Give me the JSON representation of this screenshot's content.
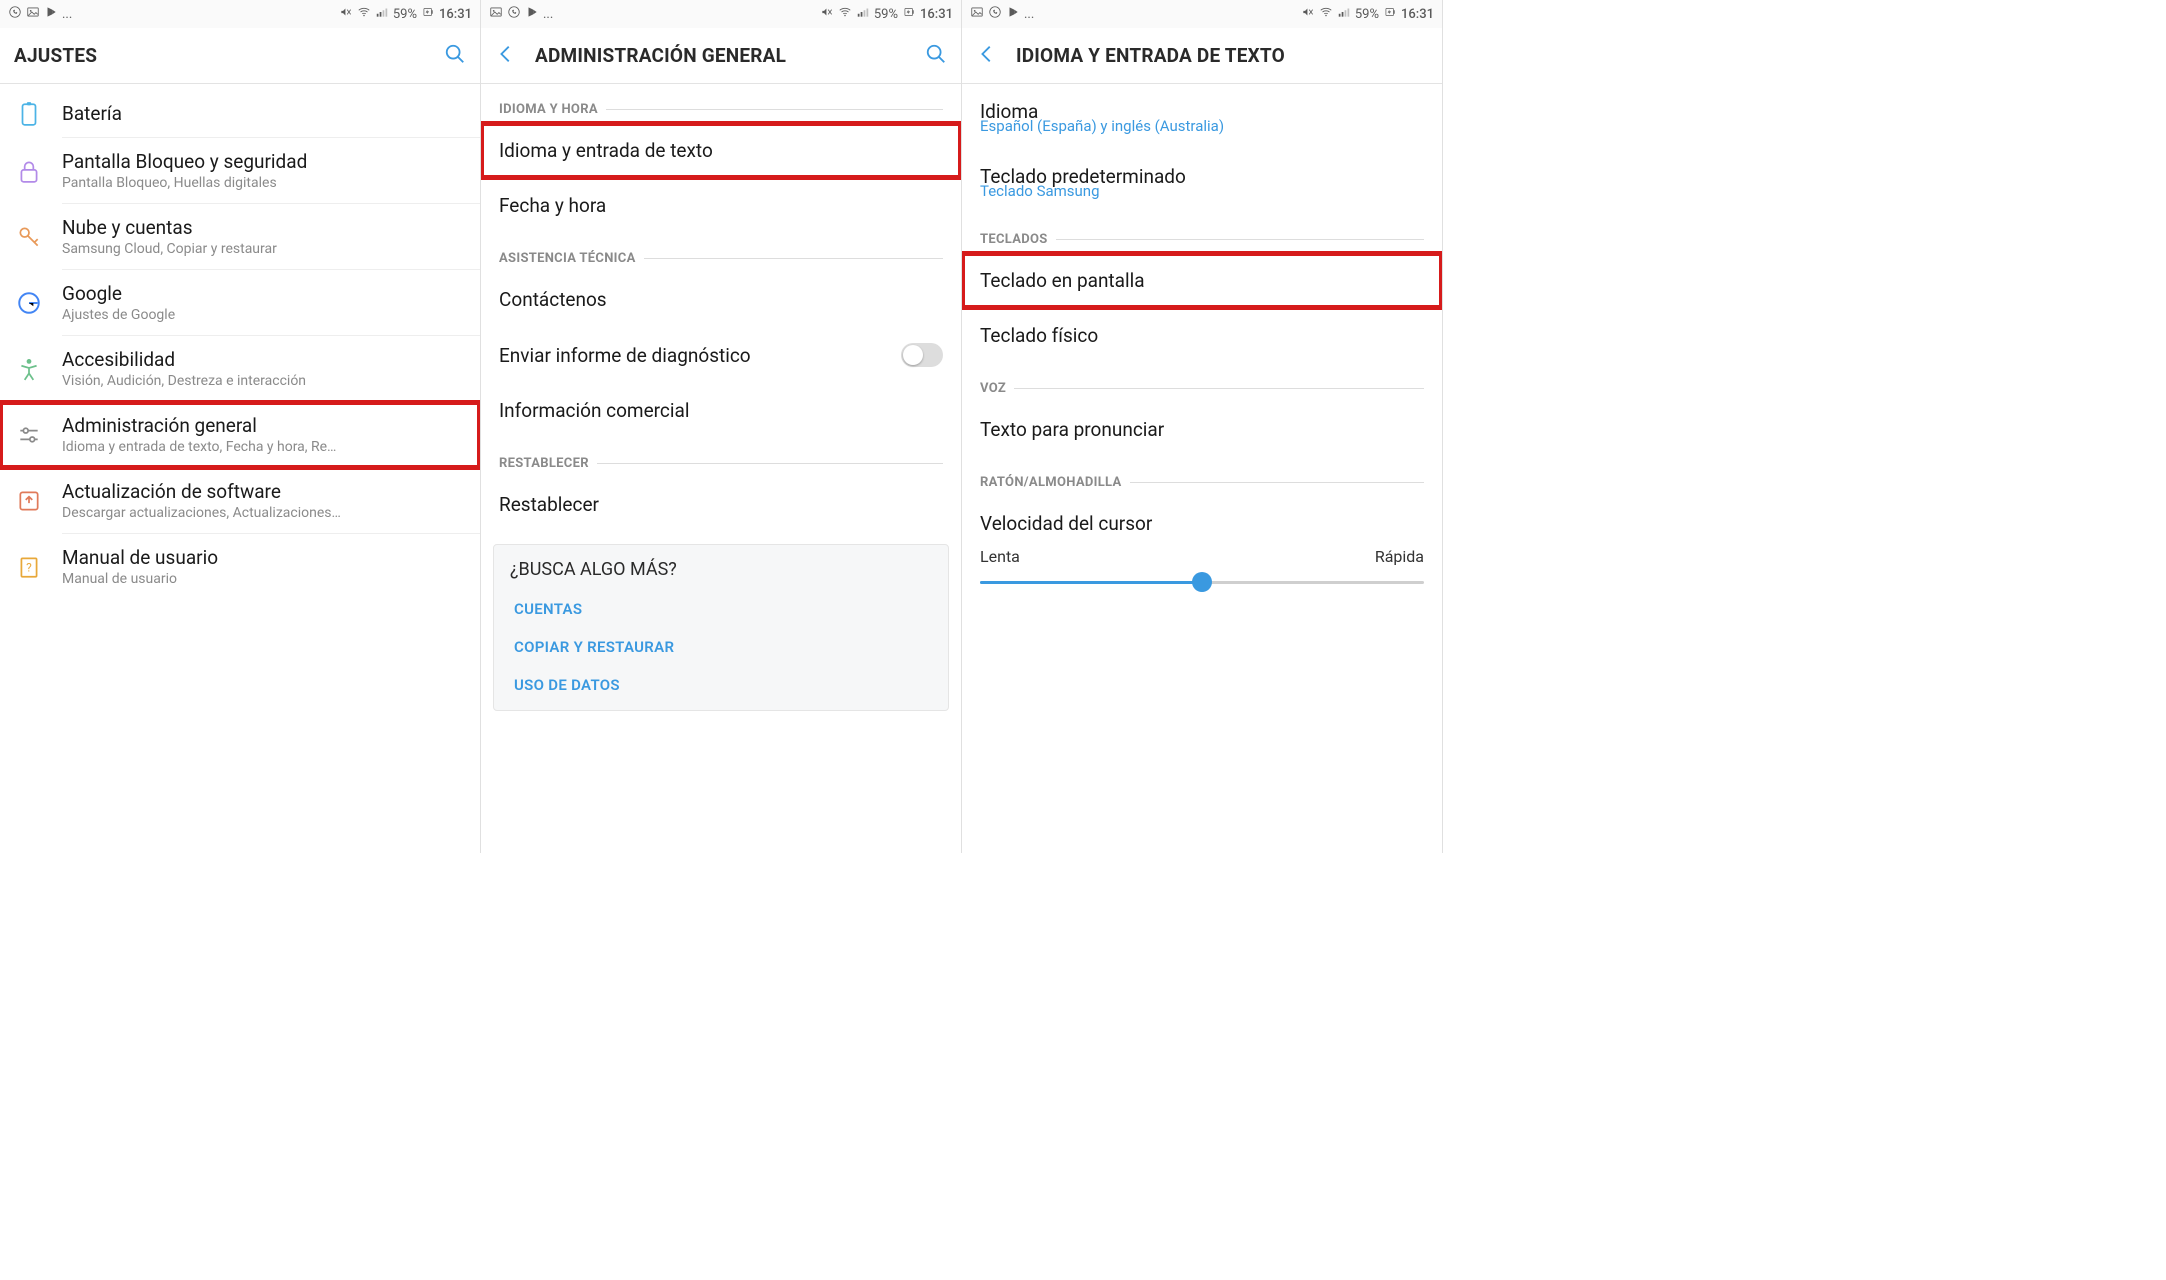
{
  "statusbar": {
    "battery_pct": "59%",
    "time": "16:31",
    "ellipsis": "..."
  },
  "panel1": {
    "title": "AJUSTES",
    "cutoff_sub": "",
    "items": [
      {
        "icon": "battery",
        "title": "Batería",
        "sub": ""
      },
      {
        "icon": "lock",
        "title": "Pantalla Bloqueo y seguridad",
        "sub": "Pantalla Bloqueo, Huellas digitales"
      },
      {
        "icon": "key",
        "title": "Nube y cuentas",
        "sub": "Samsung Cloud, Copiar y restaurar"
      },
      {
        "icon": "google",
        "title": "Google",
        "sub": "Ajustes de Google"
      },
      {
        "icon": "accessibility",
        "title": "Accesibilidad",
        "sub": "Visión, Audición, Destreza e interacción"
      },
      {
        "icon": "sliders",
        "title": "Administración general",
        "sub": "Idioma y entrada de texto, Fecha y hora, Re…",
        "highlight": true
      },
      {
        "icon": "update",
        "title": "Actualización de software",
        "sub": "Descargar actualizaciones, Actualizaciones…"
      },
      {
        "icon": "manual",
        "title": "Manual de usuario",
        "sub": "Manual de usuario"
      }
    ]
  },
  "panel2": {
    "title": "ADMINISTRACIÓN GENERAL",
    "sections": [
      {
        "header": "IDIOMA Y HORA",
        "rows": [
          {
            "label": "Idioma y entrada de texto",
            "highlight": true
          },
          {
            "label": "Fecha y hora"
          }
        ]
      },
      {
        "header": "ASISTENCIA TÉCNICA",
        "rows": [
          {
            "label": "Contáctenos"
          },
          {
            "label": "Enviar informe de diagnóstico",
            "toggle": true
          },
          {
            "label": "Información comercial"
          }
        ]
      },
      {
        "header": "RESTABLECER",
        "rows": [
          {
            "label": "Restablecer"
          }
        ]
      }
    ],
    "card": {
      "title": "¿BUSCA ALGO MÁS?",
      "links": [
        "CUENTAS",
        "COPIAR Y RESTAURAR",
        "USO DE DATOS"
      ]
    }
  },
  "panel3": {
    "title": "IDIOMA Y ENTRADA DE TEXTO",
    "top": [
      {
        "title": "Idioma",
        "sub": "Español (España) y inglés (Australia)"
      },
      {
        "title": "Teclado predeterminado",
        "sub": "Teclado Samsung"
      }
    ],
    "sections": [
      {
        "header": "TECLADOS",
        "rows": [
          {
            "label": "Teclado en pantalla",
            "highlight": true
          },
          {
            "label": "Teclado físico"
          }
        ]
      },
      {
        "header": "VOZ",
        "rows": [
          {
            "label": "Texto para pronunciar"
          }
        ]
      },
      {
        "header": "RATÓN/ALMOHADILLA",
        "rows": []
      }
    ],
    "slider": {
      "title": "Velocidad del cursor",
      "left": "Lenta",
      "right": "Rápida",
      "value_pct": 50
    }
  }
}
